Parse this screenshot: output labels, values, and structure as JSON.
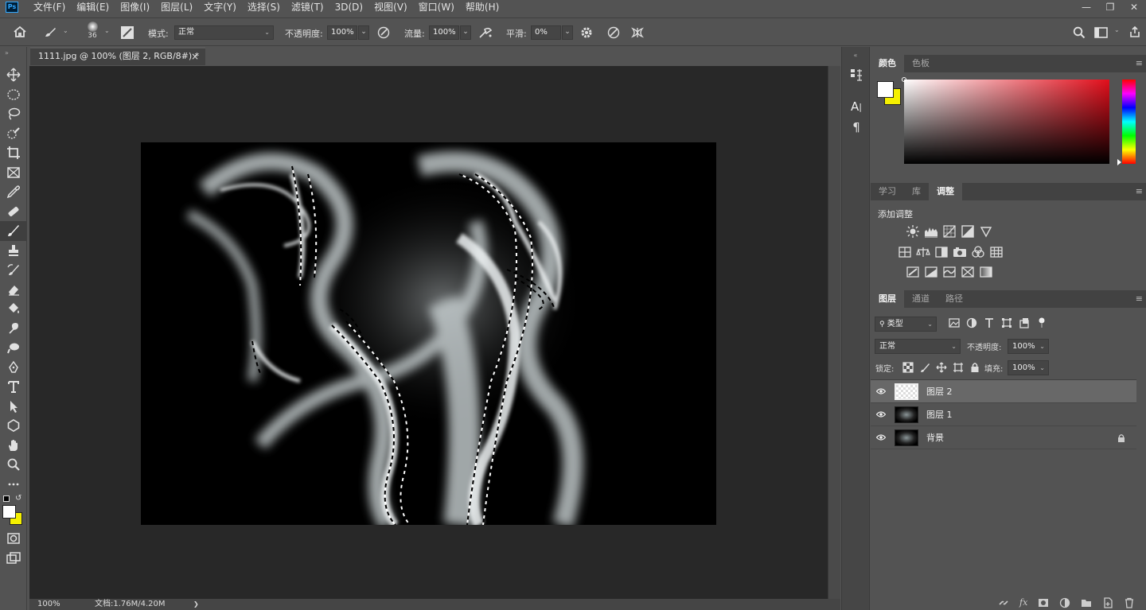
{
  "menubar": {
    "items": [
      "文件(F)",
      "编辑(E)",
      "图像(I)",
      "图层(L)",
      "文字(Y)",
      "选择(S)",
      "滤镜(T)",
      "3D(D)",
      "视图(V)",
      "窗口(W)",
      "帮助(H)"
    ],
    "logo": "Ps"
  },
  "options": {
    "brush_size": "36",
    "mode_label": "模式:",
    "mode_value": "正常",
    "opacity_label": "不透明度:",
    "opacity_value": "100%",
    "flow_label": "流量:",
    "flow_value": "100%",
    "smoothing_label": "平滑:",
    "smoothing_value": "0%"
  },
  "document": {
    "tab_title": "1111.jpg @ 100% (图层 2, RGB/8#) *",
    "close": "×",
    "zoom": "100%",
    "doc_info": "文档:1.76M/4.20M",
    "arrow": "❯"
  },
  "color_panel": {
    "tabs": [
      "颜色",
      "色板"
    ],
    "foreground": "#ffffff",
    "background": "#f5f000"
  },
  "adjustments_panel": {
    "tabs": [
      "学习",
      "库",
      "调整"
    ],
    "title": "添加调整"
  },
  "layers_panel": {
    "tabs": [
      "图层",
      "通道",
      "路径"
    ],
    "filter_label": "类型",
    "blend_mode": "正常",
    "opacity_label": "不透明度:",
    "opacity_value": "100%",
    "lock_label": "锁定:",
    "fill_label": "填充:",
    "fill_value": "100%",
    "layers": [
      {
        "name": "图层 2",
        "selected": true,
        "locked": false
      },
      {
        "name": "图层 1",
        "selected": false,
        "locked": false
      },
      {
        "name": "背景",
        "selected": false,
        "locked": true
      }
    ]
  }
}
